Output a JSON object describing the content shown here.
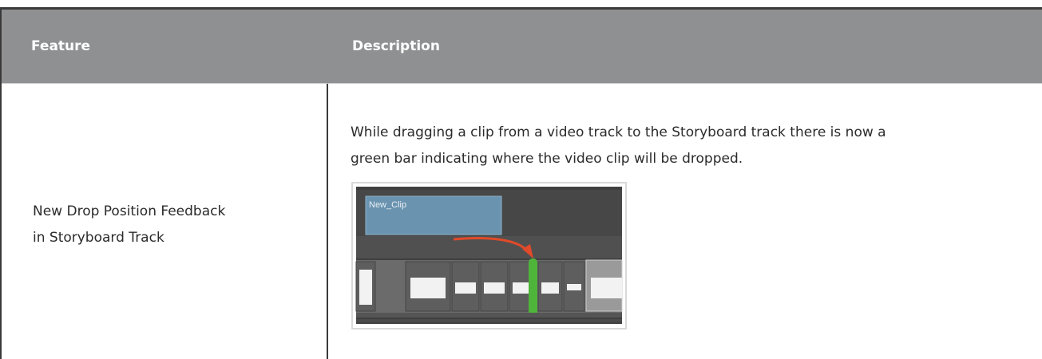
{
  "table": {
    "headers": {
      "feature": "Feature",
      "description": "Description"
    },
    "rows": [
      {
        "feature_line1": "New Drop Position Feedback",
        "feature_line2": "in Storyboard Track",
        "description_line1": "While dragging a clip from a video track to the Storyboard track there is now a",
        "description_line2": "green bar indicating where the video clip will be dropped.",
        "illustration": {
          "clip_label": "New_Clip",
          "colors": {
            "background": "#3f3f3f",
            "track": "#5a5a5a",
            "clip": "#6a93af",
            "arrow": "#e14a2a",
            "drop_bar": "#4fb43a",
            "panel": "#f2f2f2"
          }
        }
      }
    ]
  }
}
